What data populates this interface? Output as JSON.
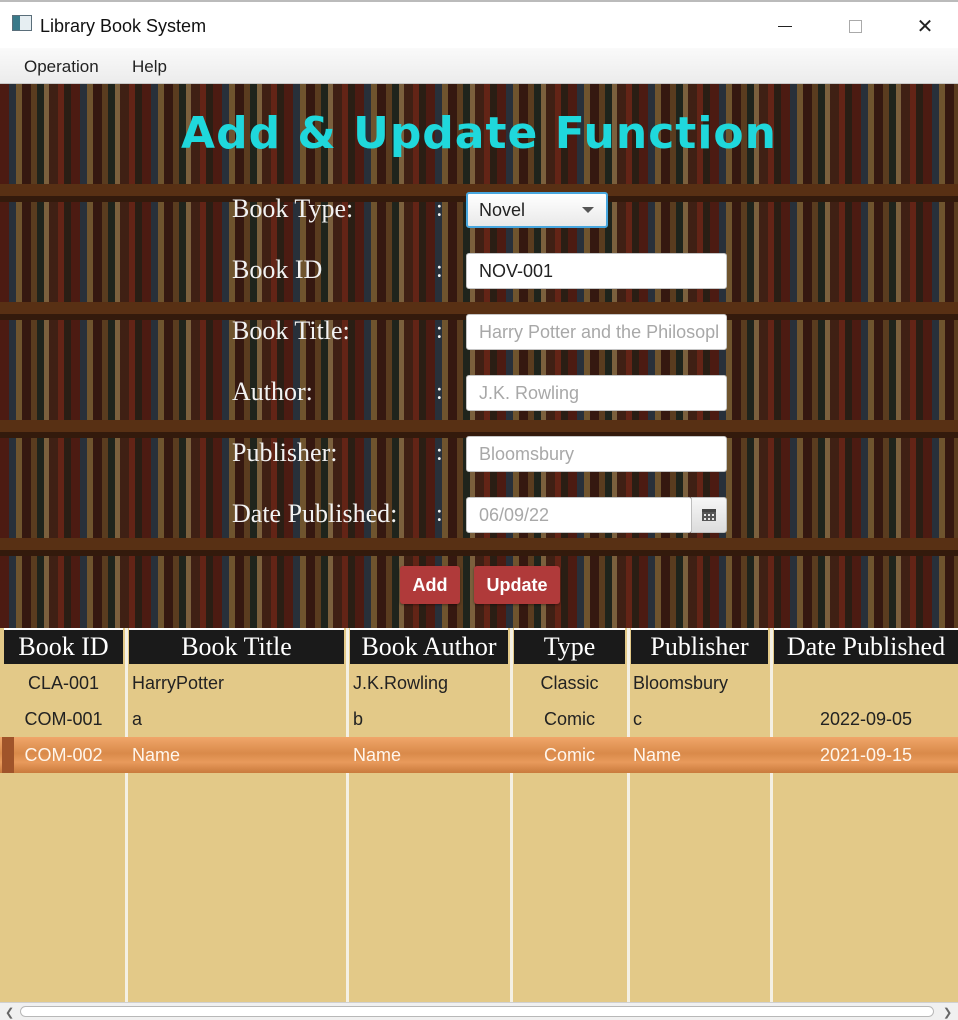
{
  "window": {
    "title": "Library Book System",
    "minimize_glyph": "—",
    "close_glyph": "✕"
  },
  "menu": {
    "items": [
      "Operation",
      "Help"
    ]
  },
  "form": {
    "heading": "Add & Update Function",
    "colon": ":",
    "book_type": {
      "label": "Book Type:",
      "value": "Novel"
    },
    "book_id": {
      "label": "Book ID",
      "value": "NOV-001"
    },
    "book_title": {
      "label": "Book Title:",
      "placeholder": "Harry Potter and the Philosopl"
    },
    "author": {
      "label": "Author:",
      "placeholder": "J.K. Rowling"
    },
    "publisher": {
      "label": "Publisher:",
      "placeholder": "Bloomsbury"
    },
    "date_published": {
      "label": "Date Published:",
      "placeholder": "06/09/22",
      "icon": "calendar-icon"
    },
    "add_label": "Add",
    "update_label": "Update"
  },
  "table": {
    "columns": [
      "Book ID",
      "Book Title",
      "Book Author",
      "Type",
      "Publisher",
      "Date Published"
    ],
    "rows": [
      [
        "CLA-001",
        "HarryPotter",
        "J.K.Rowling",
        "Classic",
        "Bloomsbury",
        ""
      ],
      [
        "COM-001",
        "a",
        "b",
        "Comic",
        "c",
        "2022-09-05"
      ],
      [
        "COM-002",
        "Name",
        "Name",
        "Comic",
        "Name",
        "2021-09-15"
      ]
    ],
    "selected_row": 2
  },
  "colors": {
    "heading": "#1fd8dc",
    "button": "#b03a3a",
    "table_bg": "#e3c988",
    "header_bg": "#1a1a1a"
  }
}
